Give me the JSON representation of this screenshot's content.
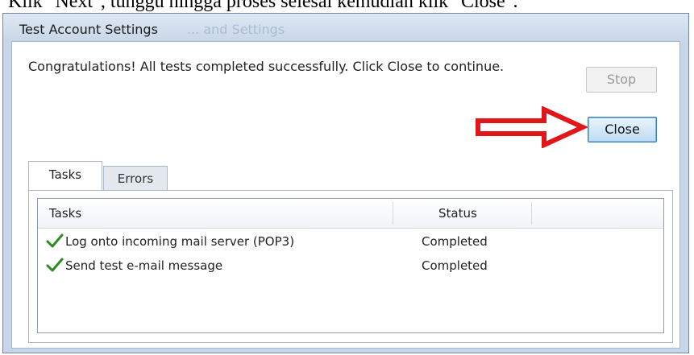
{
  "caption": "Klik \"Next\", tunggu hingga proses selesai kemudian klik \"Close\".",
  "dialog": {
    "title": "Test Account Settings",
    "title_ghost": "... and Settings",
    "message": "Congratulations! All tests completed successfully. Click Close to continue.",
    "stop_label": "Stop",
    "close_label": "Close"
  },
  "tabs": [
    {
      "label": "Tasks",
      "selected": true
    },
    {
      "label": "Errors",
      "selected": false
    }
  ],
  "table": {
    "columns": [
      "Tasks",
      "Status"
    ],
    "rows": [
      {
        "task": "Log onto incoming mail server (POP3)",
        "status": "Completed",
        "icon": "checkmark-icon"
      },
      {
        "task": "Send test e-mail message",
        "status": "Completed",
        "icon": "checkmark-icon"
      }
    ]
  },
  "colors": {
    "accent_arrow": "#e0161b",
    "check_green": "#2e8b1f",
    "close_focus_border": "#3c7fb1"
  }
}
